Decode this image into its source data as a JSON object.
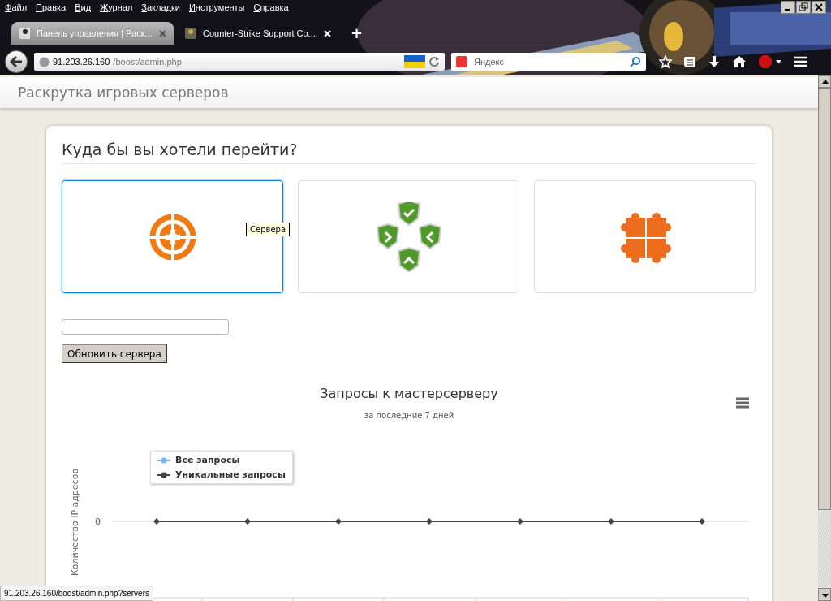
{
  "menu": [
    "Файл",
    "Правка",
    "Вид",
    "Журнал",
    "Закладки",
    "Инструменты",
    "Справка"
  ],
  "tabs": [
    {
      "label": "Панель управления | Раск...",
      "selected": true
    },
    {
      "label": "Counter-Strike Support Co...",
      "selected": false
    }
  ],
  "new_tab": "+",
  "address": {
    "host": "91.203.26.160",
    "path": "/boost/admin.php"
  },
  "search": {
    "placeholder": "Яндекс"
  },
  "site_title": "Раскрутка игровых серверов",
  "heading": "Куда бы вы хотели перейти?",
  "tiles": [
    {
      "kind": "target",
      "selected": true
    },
    {
      "kind": "shields",
      "selected": false
    },
    {
      "kind": "puzzle",
      "selected": false
    }
  ],
  "tooltip": "Сервера",
  "update_button": "Обновить сервера",
  "chart": {
    "title": "Запросы к мастерсерверу",
    "subtitle": "за последние 7 дней",
    "ylabel": "Количество IP адресов",
    "ytick": "0",
    "legend": [
      {
        "name": "Все запросы",
        "color": "#7cb5ec"
      },
      {
        "name": "Уникальные запросы",
        "color": "#434348"
      }
    ]
  },
  "status_url": "91.203.26.160/boost/admin.php?servers"
}
